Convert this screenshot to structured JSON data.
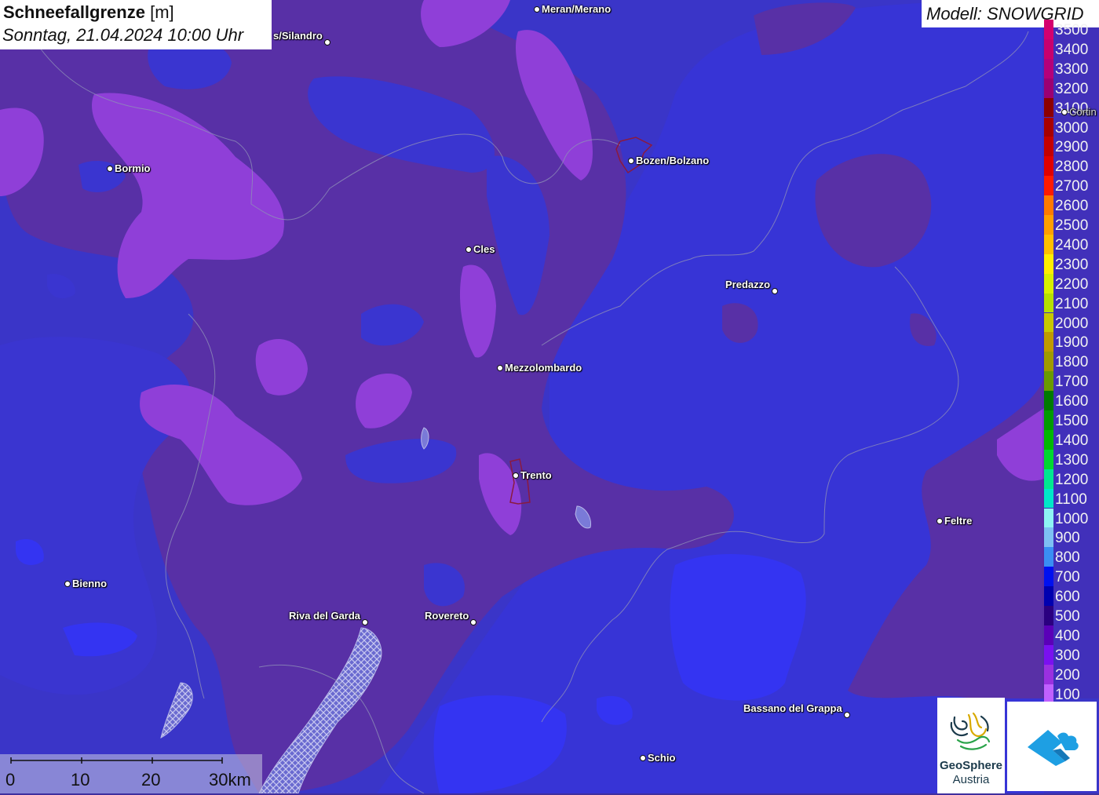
{
  "map": {
    "title": "Schneefallgrenze",
    "unit": "[m]",
    "datetime": "Sonntag, 21.04.2024 10:00 Uhr",
    "model_label": "Modell: SNOWGRID"
  },
  "legend": [
    {
      "label": "3500",
      "color": "#d4006f"
    },
    {
      "label": "3400",
      "color": "#c8006e"
    },
    {
      "label": "3300",
      "color": "#b5007a"
    },
    {
      "label": "3200",
      "color": "#9c0073"
    },
    {
      "label": "3100",
      "color": "#8c0000"
    },
    {
      "label": "3000",
      "color": "#a80000"
    },
    {
      "label": "2900",
      "color": "#c40000"
    },
    {
      "label": "2800",
      "color": "#e00000"
    },
    {
      "label": "2700",
      "color": "#ff1a00"
    },
    {
      "label": "2600",
      "color": "#ff7a00"
    },
    {
      "label": "2500",
      "color": "#ff9f00"
    },
    {
      "label": "2400",
      "color": "#ffc000"
    },
    {
      "label": "2300",
      "color": "#ffee00"
    },
    {
      "label": "2200",
      "color": "#d8f000"
    },
    {
      "label": "2100",
      "color": "#b6e000"
    },
    {
      "label": "2000",
      "color": "#c8c800"
    },
    {
      "label": "1900",
      "color": "#c09a00"
    },
    {
      "label": "1800",
      "color": "#a09a00"
    },
    {
      "label": "1700",
      "color": "#6a9a00"
    },
    {
      "label": "1600",
      "color": "#007a00"
    },
    {
      "label": "1500",
      "color": "#009a00"
    },
    {
      "label": "1400",
      "color": "#00b800"
    },
    {
      "label": "1300",
      "color": "#00d830"
    },
    {
      "label": "1200",
      "color": "#00e890"
    },
    {
      "label": "1100",
      "color": "#00e8c8"
    },
    {
      "label": "1000",
      "color": "#8ef4f4"
    },
    {
      "label": "900",
      "color": "#7ec0f4"
    },
    {
      "label": "800",
      "color": "#3a8ef4"
    },
    {
      "label": "700",
      "color": "#0010f0"
    },
    {
      "label": "600",
      "color": "#0000b0"
    },
    {
      "label": "500",
      "color": "#2a0080"
    },
    {
      "label": "400",
      "color": "#5a00b8"
    },
    {
      "label": "300",
      "color": "#7a10f0"
    },
    {
      "label": "200",
      "color": "#9a30e0"
    },
    {
      "label": "100",
      "color": "#c060ff"
    }
  ],
  "cities": [
    {
      "name": "Meran/Merano",
      "marker": "left"
    },
    {
      "name": "s/Silandro",
      "marker": "right"
    },
    {
      "name": "Bormio",
      "marker": "left"
    },
    {
      "name": "Bozen/Bolzano",
      "marker": "left"
    },
    {
      "name": "Cortin",
      "marker": "left"
    },
    {
      "name": "Cles",
      "marker": "left"
    },
    {
      "name": "Predazzo",
      "marker": "right"
    },
    {
      "name": "Mezzolombardo",
      "marker": "left"
    },
    {
      "name": "Trento",
      "marker": "left"
    },
    {
      "name": "Feltre",
      "marker": "left"
    },
    {
      "name": "Bienno",
      "marker": "left"
    },
    {
      "name": "Riva del Garda",
      "marker": "right"
    },
    {
      "name": "Rovereto",
      "marker": "right"
    },
    {
      "name": "Bassano del Grappa",
      "marker": "right"
    },
    {
      "name": "Schio",
      "marker": "left"
    }
  ],
  "scale_bar": {
    "labels": [
      "0",
      "10",
      "20",
      "30km"
    ]
  },
  "logos": {
    "geosphere": [
      "GeoSphere",
      "Austria"
    ]
  },
  "colors": {
    "base_blue": "#3a35c8",
    "mid_purple": "#5630a8",
    "light_purple": "#9040d8",
    "bright_blue": "#3030f0",
    "accent_cyan": "#1e9fe3"
  }
}
